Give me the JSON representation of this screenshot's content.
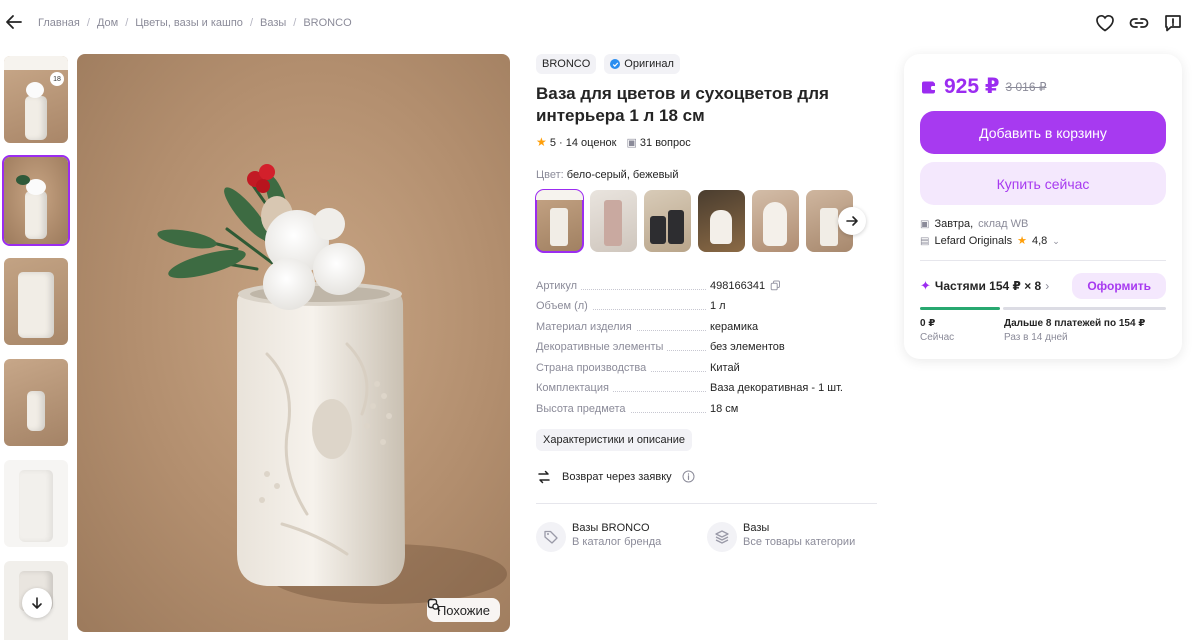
{
  "breadcrumb": [
    "Главная",
    "Дом",
    "Цветы, вазы и кашпо",
    "Вазы",
    "BRONCO"
  ],
  "breadcrumb_sep": "/",
  "thumbnails": [
    {
      "badge": "18"
    },
    {},
    {},
    {},
    {},
    {}
  ],
  "main_image": {
    "similar_label": "Похожие"
  },
  "product": {
    "brand": "BRONCO",
    "original_label": "Оригинал",
    "title": "Ваза для цветов и сухоцветов для интерьера 1 л 18 см",
    "rating": "5",
    "reviews": "· 14 оценок",
    "questions": "31 вопрос",
    "color_label": "Цвет:",
    "color_value": "бело-серый, бежевый",
    "specs": [
      {
        "key": "Артикул",
        "value": "498166341"
      },
      {
        "key": "Объем (л)",
        "value": "1 л"
      },
      {
        "key": "Материал изделия",
        "value": "керамика"
      },
      {
        "key": "Декоративные элементы",
        "value": "без элементов"
      },
      {
        "key": "Страна производства",
        "value": "Китай"
      },
      {
        "key": "Комплектация",
        "value": "Ваза декоративная - 1 шт."
      },
      {
        "key": "Высота предмета",
        "value": "18 см"
      }
    ],
    "chars_button": "Характеристики и описание",
    "return_label": "Возврат через заявку",
    "cat_links": [
      {
        "title": "Вазы BRONCO",
        "subtitle": "В каталог бренда"
      },
      {
        "title": "Вазы",
        "subtitle": "Все товары категории"
      }
    ]
  },
  "buy": {
    "price": "925 ₽",
    "old_price": "3 016 ₽",
    "cart_button": "Добавить в корзину",
    "buy_button": "Купить сейчас",
    "delivery": "Завтра,",
    "warehouse": "склад WB",
    "seller": "Lefard Originals",
    "seller_rating": "4,8",
    "installments": "Частями 154 ₽ × 8",
    "installments_button": "Оформить",
    "installments_progress": 0.125,
    "plan_now_amount": "0 ₽",
    "plan_now_label": "Сейчас",
    "plan_next_amount": "Дальше 8 платежей по 154 ₽",
    "plan_next_label": "Раз в 14 дней"
  },
  "colors": {
    "accent": "#9b2cf0",
    "button": "#a73af0",
    "star": "#ff9f0a",
    "progress": "#28a870"
  }
}
